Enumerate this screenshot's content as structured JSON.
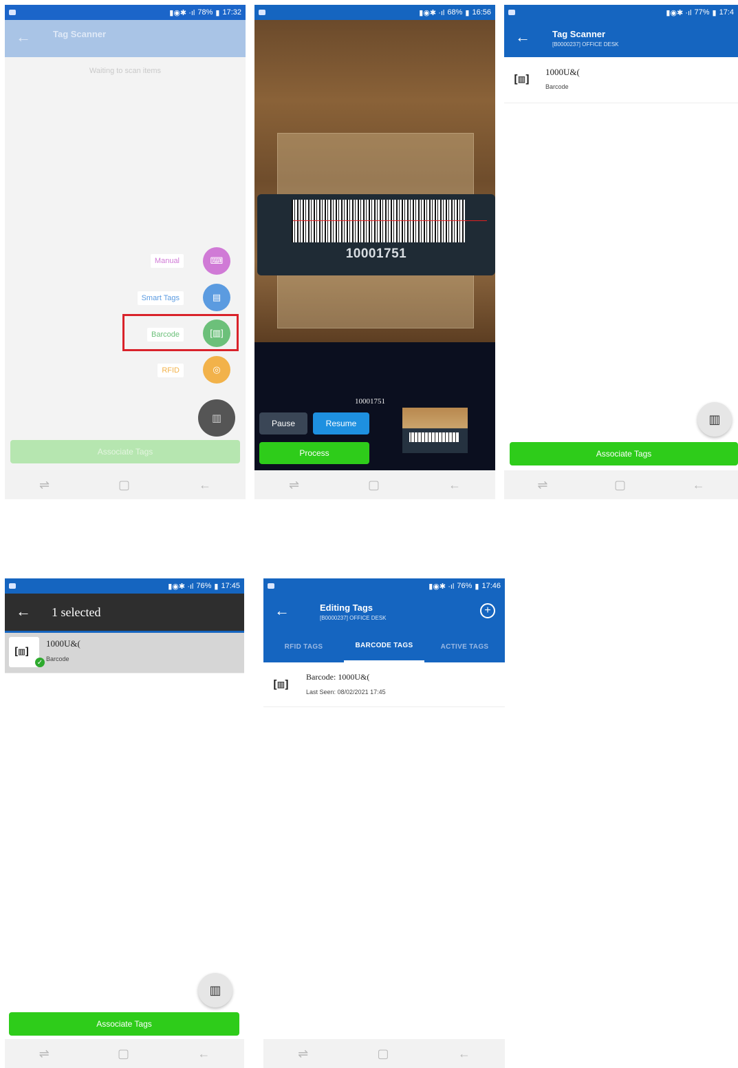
{
  "phone1": {
    "status": {
      "battery": "78%",
      "time": "17:32"
    },
    "title": "Tag Scanner",
    "subtitle": "",
    "waiting_text": "Waiting to scan items",
    "menu": [
      {
        "label": "Manual",
        "icon": "keyboard-icon",
        "color": "#d07ad6"
      },
      {
        "label": "Smart Tags",
        "icon": "printer-icon",
        "color": "#5b9be0"
      },
      {
        "label": "Barcode",
        "icon": "barcode-icon",
        "color": "#6cc07a"
      },
      {
        "label": "RFID",
        "icon": "rfid-icon",
        "color": "#f2b24a"
      }
    ],
    "associate_label": "Associate Tags"
  },
  "phone2": {
    "status": {
      "battery": "68%",
      "time": "16:56"
    },
    "tag_number": "10001751",
    "scanned_value": "10001751",
    "pause_label": "Pause",
    "resume_label": "Resume",
    "process_label": "Process"
  },
  "phone3": {
    "status": {
      "battery": "77%",
      "time": "17:4"
    },
    "title": "Tag Scanner",
    "subtitle": "[B0000237] OFFICE DESK",
    "item": {
      "code": "1000U&(",
      "type": "Barcode"
    },
    "associate_label": "Associate Tags"
  },
  "phone4": {
    "status": {
      "battery": "76%",
      "time": "17:45"
    },
    "selected_title": "1 selected",
    "item": {
      "code": "1000U&(",
      "type": "Barcode"
    },
    "associate_label": "Associate Tags"
  },
  "phone5": {
    "status": {
      "battery": "76%",
      "time": "17:46"
    },
    "title": "Editing Tags",
    "subtitle": "[B0000237] OFFICE DESK",
    "tabs": [
      "RFID TAGS",
      "BARCODE TAGS",
      "ACTIVE TAGS"
    ],
    "item": {
      "code_label": "Barcode: 1000U&(",
      "last_seen": "Last Seen: 08/02/2021 17:45"
    }
  },
  "nav_icons": [
    "recent-apps-icon",
    "home-icon",
    "back-icon"
  ]
}
